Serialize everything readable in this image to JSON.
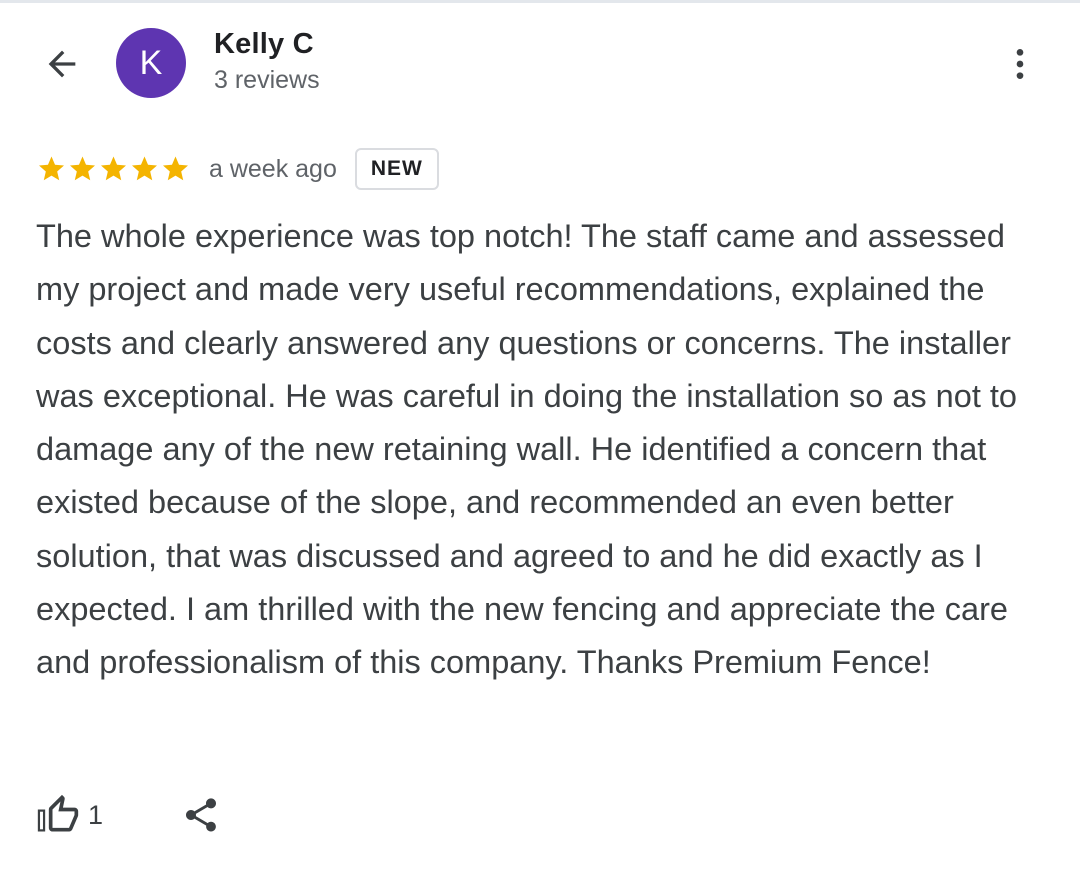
{
  "reviewer": {
    "initial": "K",
    "name": "Kelly C",
    "review_count": "3 reviews",
    "avatar_color": "#5e35b1"
  },
  "icons": {
    "back": "arrow-back-icon",
    "more": "more-vertical-icon",
    "star": "star-icon",
    "like": "thumb-up-icon",
    "share": "share-icon"
  },
  "review": {
    "rating": 5,
    "max_rating": 5,
    "time": "a week ago",
    "badge": "NEW",
    "text": "The whole experience was top notch! The staff came and assessed my project and made very useful recommendations, explained the costs and clearly answered any questions or concerns. The installer was exceptional. He was careful in doing the installation so as not to damage any of the new retaining wall. He identified a concern that existed because of the slope, and recommended an even better solution, that was discussed and agreed to and he did exactly as I expected. I am thrilled with the new fencing and appreciate the care and professionalism of this company. Thanks Premium Fence!",
    "star_color": "#f4b400"
  },
  "actions": {
    "like_count": "1"
  }
}
